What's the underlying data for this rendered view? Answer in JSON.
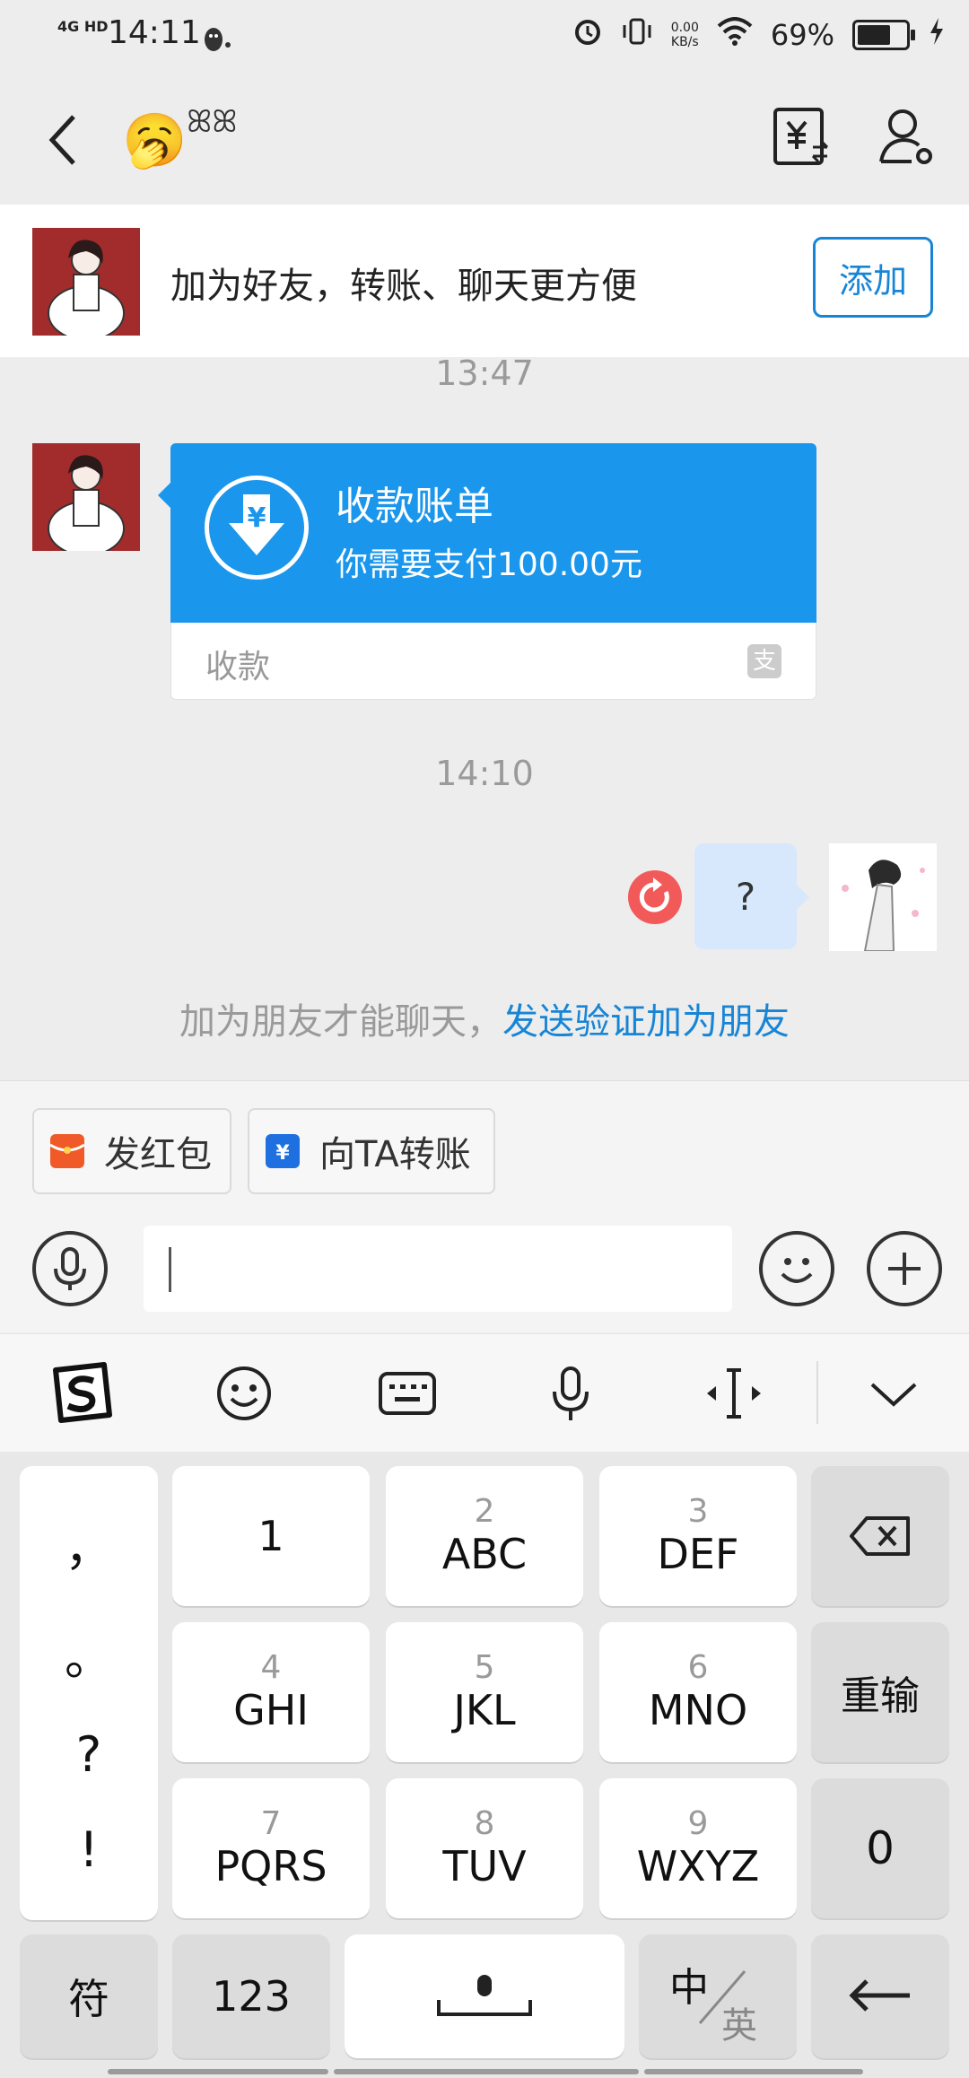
{
  "status_bar": {
    "network": "4G HD",
    "time": "14:11",
    "speed_value": "0.00",
    "speed_unit": "KB/s",
    "battery": "69%"
  },
  "nav": {
    "title_emoji": "🥱",
    "title_sprouts": "ꕤꕤ"
  },
  "banner": {
    "text": "加为好友，转账、聊天更方便",
    "add_button": "添加"
  },
  "messages": {
    "timestamp1": "13:47",
    "card_title": "收款账单",
    "card_amount": "你需要支付100.00元",
    "card_footer": "收款",
    "card_currency": "¥",
    "card_alipay": "支",
    "timestamp2": "14:10",
    "my_message": "?"
  },
  "notice": {
    "prefix": "加为朋友才能聊天，",
    "link": "发送验证加为朋友"
  },
  "chips": {
    "red_packet": "发红包",
    "transfer": "向TA转账"
  },
  "keyboard": {
    "punct": [
      "，",
      "。",
      "?",
      "!"
    ],
    "keys": [
      {
        "num": "",
        "letters": "1"
      },
      {
        "num": "2",
        "letters": "ABC"
      },
      {
        "num": "3",
        "letters": "DEF"
      },
      {
        "num": "4",
        "letters": "GHI"
      },
      {
        "num": "5",
        "letters": "JKL"
      },
      {
        "num": "6",
        "letters": "MNO"
      },
      {
        "num": "7",
        "letters": "PQRS"
      },
      {
        "num": "8",
        "letters": "TUV"
      },
      {
        "num": "9",
        "letters": "WXYZ"
      }
    ],
    "reenter": "重输",
    "zero": "0",
    "symbols": "符",
    "numbers": "123",
    "lang_zh": "中",
    "lang_en": "英"
  }
}
